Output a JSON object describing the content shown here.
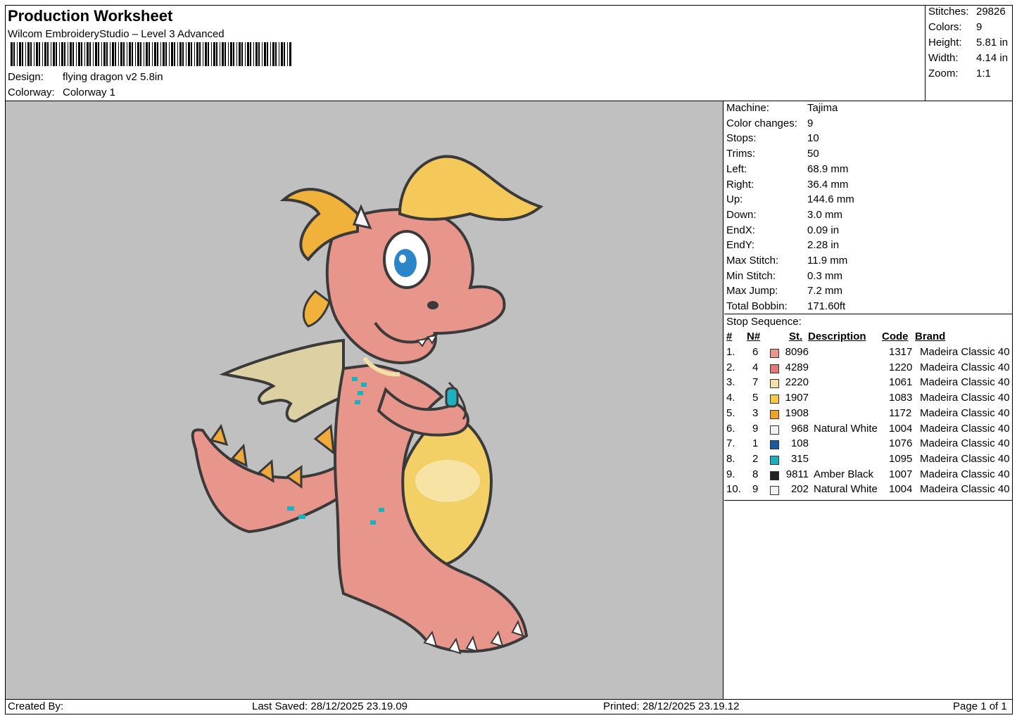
{
  "header": {
    "title": "Production Worksheet",
    "software": "Wilcom EmbroideryStudio – Level 3 Advanced",
    "design_label": "Design:",
    "design_value": "flying dragon v2 5.8in",
    "colorway_label": "Colorway:",
    "colorway_value": "Colorway 1"
  },
  "summary": [
    {
      "label": "Stitches:",
      "value": "29826"
    },
    {
      "label": "Colors:",
      "value": "9"
    },
    {
      "label": "Height:",
      "value": "5.81 in"
    },
    {
      "label": "Width:",
      "value": "4.14 in"
    },
    {
      "label": "Zoom:",
      "value": "1:1"
    }
  ],
  "machine_info": [
    {
      "label": "Machine:",
      "value": "Tajima"
    },
    {
      "label": "Color changes:",
      "value": "9"
    },
    {
      "label": "Stops:",
      "value": "10"
    },
    {
      "label": "Trims:",
      "value": "50"
    },
    {
      "label": "Left:",
      "value": "68.9 mm"
    },
    {
      "label": "Right:",
      "value": "36.4 mm"
    },
    {
      "label": "Up:",
      "value": "144.6 mm"
    },
    {
      "label": "Down:",
      "value": "3.0 mm"
    },
    {
      "label": "EndX:",
      "value": "0.09 in"
    },
    {
      "label": "EndY:",
      "value": "2.28 in"
    },
    {
      "label": "Max Stitch:",
      "value": "11.9 mm"
    },
    {
      "label": "Min Stitch:",
      "value": "0.3 mm"
    },
    {
      "label": "Max Jump:",
      "value": "7.2 mm"
    },
    {
      "label": "Total Bobbin:",
      "value": "171.60ft"
    }
  ],
  "stop_sequence": {
    "title": "Stop Sequence:",
    "headers": {
      "num": "#",
      "needle": "N#",
      "st": "St.",
      "description": "Description",
      "code": "Code",
      "brand": "Brand"
    },
    "rows": [
      {
        "num": "1.",
        "needle": "6",
        "color": "#e8958c",
        "st": "8096",
        "description": "",
        "code": "1317",
        "brand": "Madeira Classic 40"
      },
      {
        "num": "2.",
        "needle": "4",
        "color": "#e07a7a",
        "st": "4289",
        "description": "",
        "code": "1220",
        "brand": "Madeira Classic 40"
      },
      {
        "num": "3.",
        "needle": "7",
        "color": "#f5dfa8",
        "st": "2220",
        "description": "",
        "code": "1061",
        "brand": "Madeira Classic 40"
      },
      {
        "num": "4.",
        "needle": "5",
        "color": "#f7c84a",
        "st": "1907",
        "description": "",
        "code": "1083",
        "brand": "Madeira Classic 40"
      },
      {
        "num": "5.",
        "needle": "3",
        "color": "#eea32a",
        "st": "1908",
        "description": "",
        "code": "1172",
        "brand": "Madeira Classic 40"
      },
      {
        "num": "6.",
        "needle": "9",
        "color": "#f2f2f2",
        "st": "968",
        "description": "Natural White",
        "code": "1004",
        "brand": "Madeira Classic 40"
      },
      {
        "num": "7.",
        "needle": "1",
        "color": "#1a5a9c",
        "st": "108",
        "description": "",
        "code": "1076",
        "brand": "Madeira Classic 40"
      },
      {
        "num": "8.",
        "needle": "2",
        "color": "#1fb0c0",
        "st": "315",
        "description": "",
        "code": "1095",
        "brand": "Madeira Classic 40"
      },
      {
        "num": "9.",
        "needle": "8",
        "color": "#222222",
        "st": "9811",
        "description": "Amber Black",
        "code": "1007",
        "brand": "Madeira Classic 40"
      },
      {
        "num": "10.",
        "needle": "9",
        "color": "#f2f2f2",
        "st": "202",
        "description": "Natural White",
        "code": "1004",
        "brand": "Madeira Classic 40"
      }
    ]
  },
  "footer": {
    "created_by": "Created By:",
    "last_saved": "Last Saved: 28/12/2025 23.19.09",
    "printed": "Printed: 28/12/2025 23.19.12",
    "page": "Page 1 of 1"
  }
}
